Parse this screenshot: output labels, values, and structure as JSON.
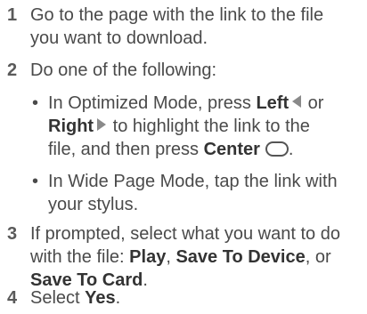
{
  "steps": [
    {
      "number": "1",
      "lines": [
        "Go to the page with the link to the file",
        "you want to download."
      ]
    },
    {
      "number": "2",
      "text": "Do one of the following:",
      "bullets": [
        {
          "marker": "•",
          "part1": "In Optimized Mode, press ",
          "left_label": "Left",
          "or_text": " or",
          "right_label": "Right",
          "part2": " to highlight the link to the",
          "part3": "file, and then press ",
          "center_label": "Center",
          "end": "."
        },
        {
          "marker": "•",
          "lines": [
            "In Wide Page Mode, tap the link with",
            "your stylus."
          ]
        }
      ]
    },
    {
      "number": "3",
      "line1": "If prompted, select what you want to do",
      "line2_prefix": "with the file: ",
      "play_label": "Play",
      "sep1": ", ",
      "save_device_label": "Save To Device",
      "sep2": ", or",
      "save_card_label": "Save To Card",
      "end": "."
    },
    {
      "number": "4",
      "prefix": "Select ",
      "yes_label": "Yes",
      "end": "."
    }
  ],
  "icons": {
    "left": "left-arrow-icon",
    "right": "right-arrow-icon",
    "center": "center-button-icon"
  },
  "colors": {
    "text": "#4a4a4a",
    "bold": "#333333",
    "arrow": "#8a8a8a"
  }
}
